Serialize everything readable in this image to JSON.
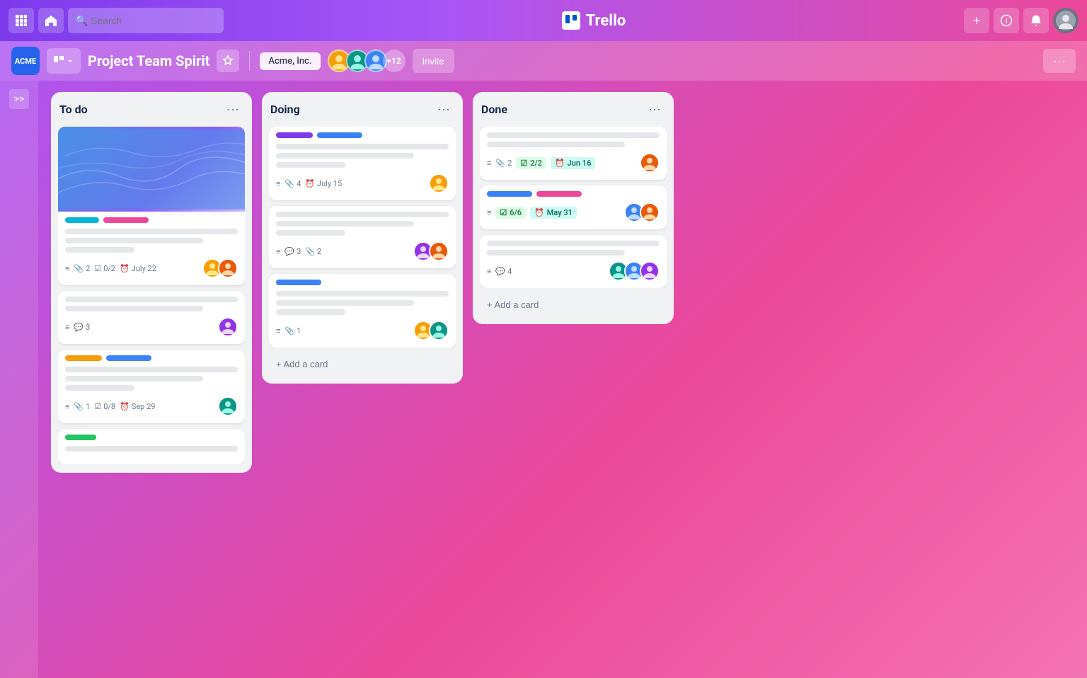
{
  "app": {
    "name": "Trello"
  },
  "topNav": {
    "searchPlaceholder": "Search",
    "addLabel": "+",
    "infoLabel": "ℹ",
    "bellLabel": "🔔"
  },
  "boardHeader": {
    "workspaceLogo": "ACME",
    "viewIcon": "⊞",
    "boardTitle": "Project Team Spirit",
    "workspaceName": "Acme, Inc.",
    "memberCount": "+12",
    "inviteLabel": "Invite",
    "moreLabel": "···"
  },
  "sidebar": {
    "chevronLabel": ">>"
  },
  "lists": [
    {
      "id": "todo",
      "title": "To do",
      "cards": [
        {
          "id": "card1",
          "hasCover": true,
          "tags": [
            {
              "color": "cyan",
              "label": ""
            },
            {
              "color": "pink",
              "label": ""
            }
          ],
          "lines": [
            "full",
            "medium",
            "xshort"
          ],
          "meta": [
            {
              "icon": "≡",
              "value": ""
            },
            {
              "icon": "📎",
              "value": "2"
            },
            {
              "icon": "☑",
              "value": "0/2"
            },
            {
              "icon": "⏰",
              "value": "July 22"
            }
          ],
          "avatars": [
            "yellow",
            "orange"
          ]
        },
        {
          "id": "card2",
          "hasCover": false,
          "tags": [],
          "lines": [
            "full",
            "medium"
          ],
          "meta": [
            {
              "icon": "≡",
              "value": ""
            },
            {
              "icon": "💬",
              "value": "3"
            }
          ],
          "avatars": [
            "purple"
          ]
        },
        {
          "id": "card3",
          "hasCover": false,
          "tags": [
            {
              "color": "yellow",
              "label": ""
            },
            {
              "color": "blue",
              "label": ""
            }
          ],
          "lines": [
            "full",
            "medium",
            "xshort"
          ],
          "meta": [
            {
              "icon": "≡",
              "value": ""
            },
            {
              "icon": "📎",
              "value": "1"
            },
            {
              "icon": "☑",
              "value": "0/8"
            },
            {
              "icon": "⏰",
              "value": "Sep 29"
            }
          ],
          "avatars": [
            "teal"
          ]
        },
        {
          "id": "card4",
          "hasCover": false,
          "tags": [
            {
              "color": "green",
              "label": ""
            }
          ],
          "lines": [
            "full"
          ],
          "meta": [],
          "avatars": []
        }
      ]
    },
    {
      "id": "doing",
      "title": "Doing",
      "cards": [
        {
          "id": "card5",
          "hasCover": false,
          "tags": [
            {
              "color": "purple",
              "label": ""
            },
            {
              "color": "blue",
              "label": ""
            }
          ],
          "lines": [
            "full",
            "medium",
            "xshort"
          ],
          "meta": [
            {
              "icon": "≡",
              "value": ""
            },
            {
              "icon": "📎",
              "value": "4"
            },
            {
              "icon": "⏰",
              "value": "July 15"
            }
          ],
          "avatars": [
            "yellow"
          ]
        },
        {
          "id": "card6",
          "hasCover": false,
          "tags": [],
          "lines": [
            "full",
            "medium",
            "xshort"
          ],
          "meta": [
            {
              "icon": "≡",
              "value": ""
            },
            {
              "icon": "💬",
              "value": "3"
            },
            {
              "icon": "📎",
              "value": "2"
            }
          ],
          "avatars": [
            "purple",
            "orange"
          ]
        },
        {
          "id": "card7",
          "hasCover": false,
          "tags": [
            {
              "color": "blue",
              "label": ""
            }
          ],
          "lines": [
            "full",
            "medium",
            "xshort"
          ],
          "meta": [
            {
              "icon": "≡",
              "value": ""
            },
            {
              "icon": "📎",
              "value": "1"
            }
          ],
          "avatars": [
            "yellow",
            "teal"
          ]
        }
      ],
      "addCardLabel": "+ Add a card"
    },
    {
      "id": "done",
      "title": "Done",
      "cards": [
        {
          "id": "card8",
          "hasCover": false,
          "tags": [],
          "lines": [
            "full",
            "medium"
          ],
          "meta": [
            {
              "icon": "≡",
              "value": ""
            },
            {
              "icon": "📎",
              "value": "2"
            }
          ],
          "badges": [
            {
              "type": "green",
              "label": "2/2",
              "icon": "☑"
            },
            {
              "type": "teal",
              "label": "Jun 16",
              "icon": "⏰"
            }
          ],
          "avatars": [
            "orange"
          ]
        },
        {
          "id": "card9",
          "hasCover": false,
          "tags": [
            {
              "color": "blue",
              "label": ""
            },
            {
              "color": "pink",
              "label": ""
            }
          ],
          "lines": [],
          "meta": [
            {
              "icon": "≡",
              "value": ""
            },
            {
              "icon": "☑",
              "value": "6/6"
            },
            {
              "icon": "⏰",
              "value": "May 31"
            }
          ],
          "badges": [
            {
              "type": "green",
              "label": "6/6",
              "icon": "☑"
            },
            {
              "type": "teal",
              "label": "May 31",
              "icon": "⏰"
            }
          ],
          "avatars": [
            "blue",
            "orange"
          ]
        },
        {
          "id": "card10",
          "hasCover": false,
          "tags": [],
          "lines": [
            "full",
            "medium"
          ],
          "meta": [
            {
              "icon": "≡",
              "value": ""
            },
            {
              "icon": "💬",
              "value": "4"
            }
          ],
          "avatars": [
            "teal",
            "blue",
            "purple"
          ]
        }
      ],
      "addCardLabel": "+ Add a card"
    }
  ]
}
